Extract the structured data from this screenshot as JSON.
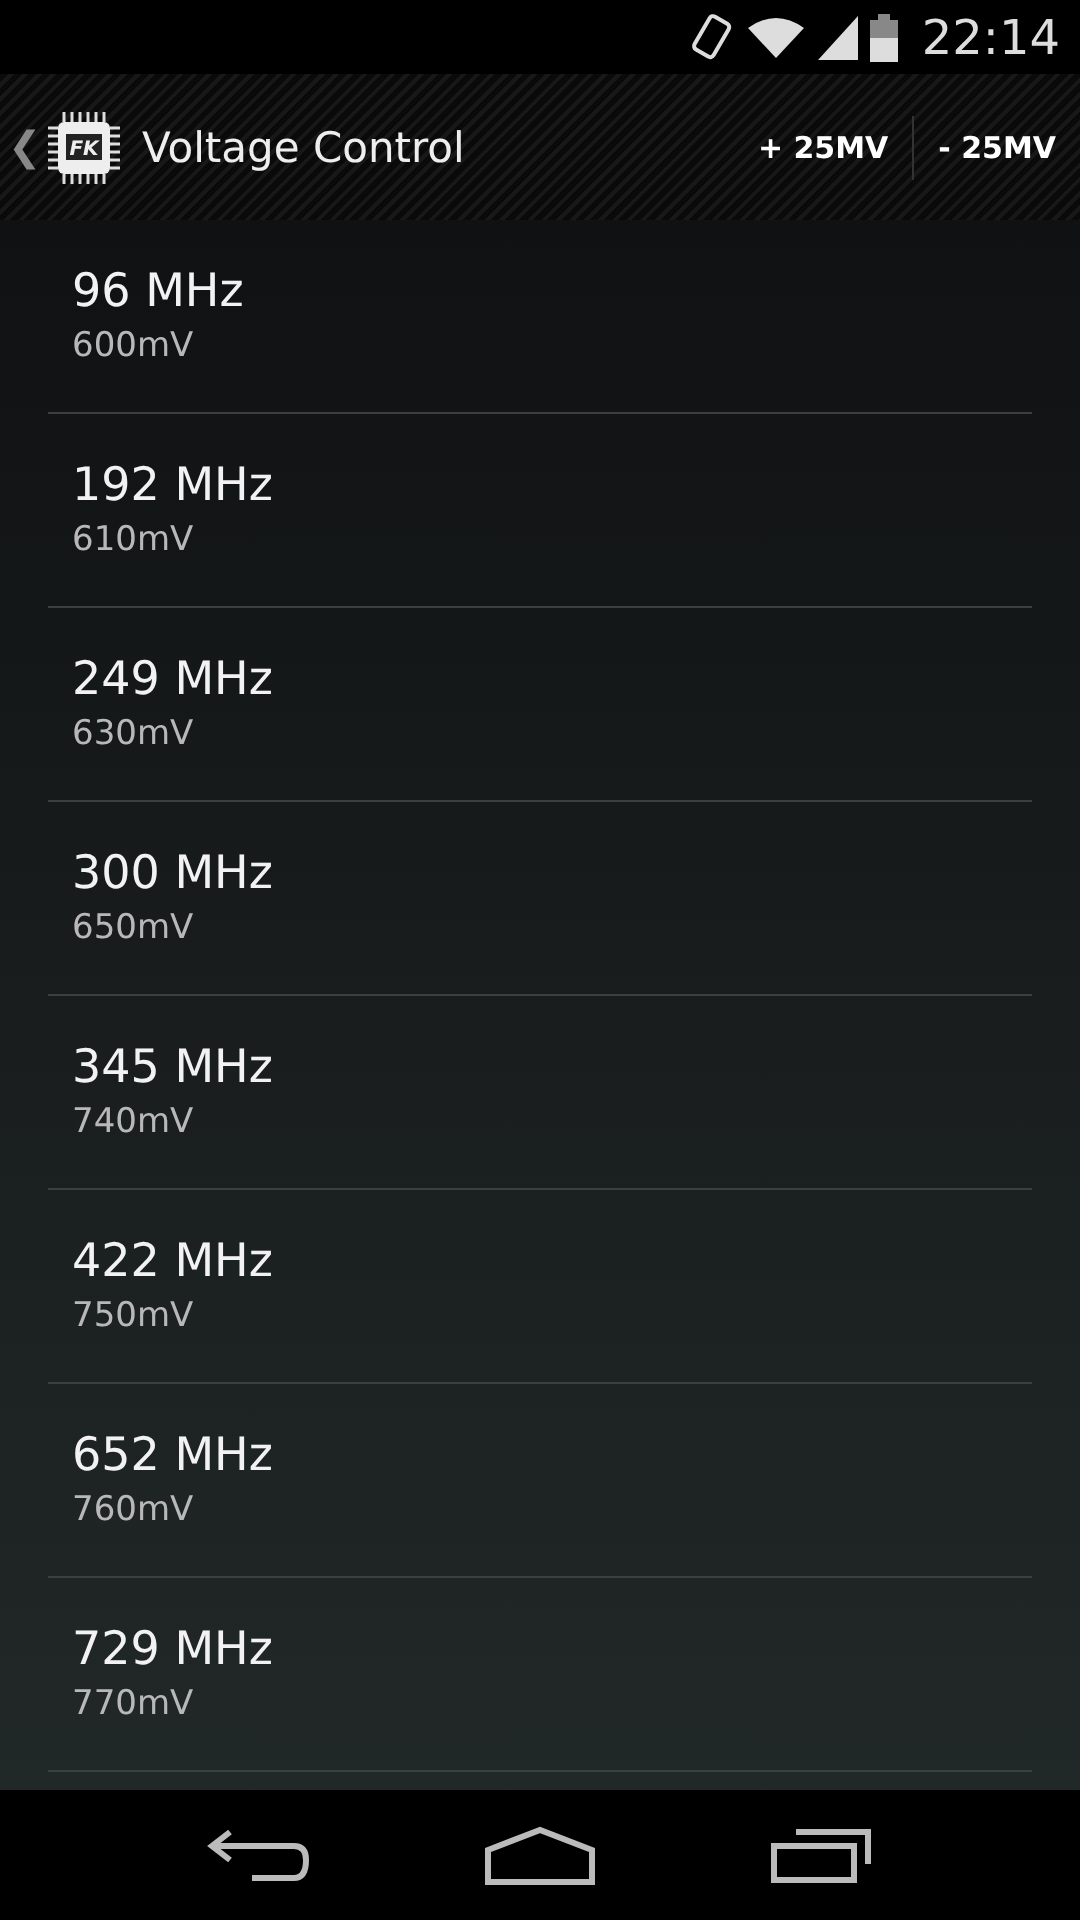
{
  "status_bar": {
    "time": "22:14"
  },
  "action_bar": {
    "back": "❮",
    "logo_text": "FK",
    "title": "Voltage Control",
    "actions": [
      "+ 25MV",
      "- 25MV"
    ]
  },
  "frequencies": [
    {
      "frequency": "96 MHz",
      "voltage": "600mV"
    },
    {
      "frequency": "192 MHz",
      "voltage": "610mV"
    },
    {
      "frequency": "249 MHz",
      "voltage": "630mV"
    },
    {
      "frequency": "300 MHz",
      "voltage": "650mV"
    },
    {
      "frequency": "345 MHz",
      "voltage": "740mV"
    },
    {
      "frequency": "422 MHz",
      "voltage": "750mV"
    },
    {
      "frequency": "652 MHz",
      "voltage": "760mV"
    },
    {
      "frequency": "729 MHz",
      "voltage": "770mV"
    }
  ]
}
